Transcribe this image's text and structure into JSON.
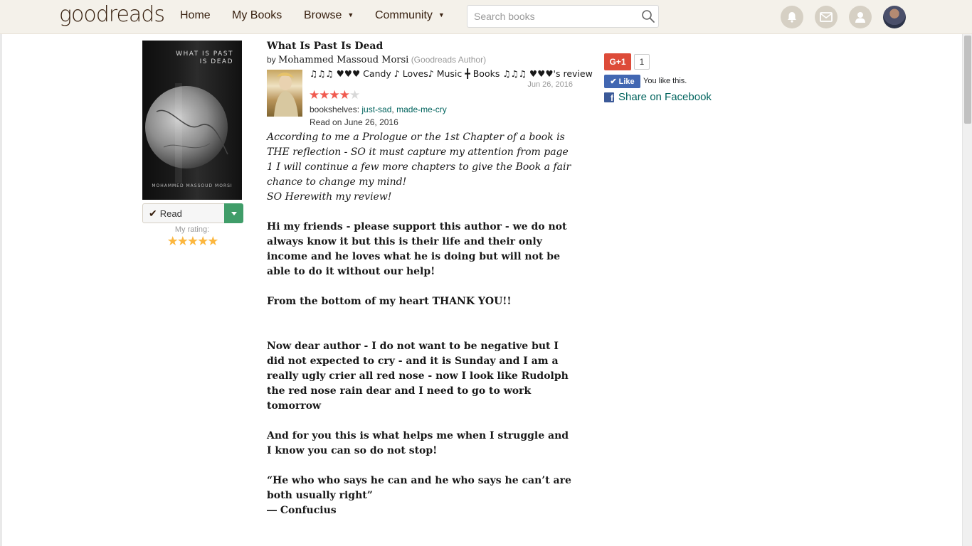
{
  "nav": {
    "logo_good": "good",
    "logo_reads": "reads",
    "home": "Home",
    "my_books": "My Books",
    "browse": "Browse",
    "community": "Community",
    "search_placeholder": "Search books"
  },
  "book": {
    "cover_title_line1": "WHAT IS PAST",
    "cover_title_line2": "IS DEAD",
    "cover_author": "MOHAMMED MASSOUD MORSI",
    "title": "What Is Past Is Dead",
    "by": "by",
    "author": "Mohammed Massoud Morsi",
    "author_badge": "(Goodreads Author)"
  },
  "shelf": {
    "read_label": "Read",
    "my_rating_label": "My rating:",
    "my_rating": 5,
    "my_rating_stars": "★★★★★"
  },
  "review": {
    "reviewer": "♫♫♫ ♥♥♥ Candy ♪ Loves♪ Music ╋ Books ♫♫♫ ♥♥♥'s review",
    "date": "Jun 26, 2016",
    "rating": 4,
    "rating_max": 5,
    "stars_on": "★★★★",
    "stars_off": "★",
    "bookshelves_label": "bookshelves:",
    "shelf1": "just-sad",
    "shelf_sep": ",",
    "shelf2": "made-me-cry",
    "read_on": "Read on June 26, 2016",
    "p1": "According to me a Prologue or the 1st Chapter of a book is THE reflection - SO it must capture my attention from page 1 I will continue a few more chapters to give the Book a fair chance to change my mind!",
    "p2": "SO Herewith my review!",
    "p3": "Hi my friends - please support this author - we do not always know it but this is their life and their only income and he loves what he is doing but will not be able to do it without our help!",
    "p4": "From the bottom of my heart THANK YOU!!",
    "p5": "Now dear author - I do not want to be negative but I did not expected to cry - and it is Sunday and I am a really ugly crier all red nose - now I look like Rudolph the red nose rain dear and I need to go to work tomorrow",
    "p6": "And for you this is what helps me when I struggle and I know you can so do not stop!",
    "p7": "“He who who says he can and he who says he can’t are both usually right”",
    "p8": "― Confucius"
  },
  "social": {
    "gplus_label": "G+1",
    "gplus_count": "1",
    "fb_like_label": "Like",
    "fb_like_text": "You like this.",
    "fb_share_label": "Share on Facebook"
  },
  "icons": {
    "search": "search-icon",
    "notifications": "bell-icon",
    "messages": "mail-icon",
    "friends": "friends-icon",
    "profile": "avatar",
    "check": "check-icon",
    "dropdown": "caret-down-icon",
    "facebook": "facebook-icon"
  },
  "colors": {
    "topbar_bg": "#f4f1ea",
    "brand_brown": "#382110",
    "shelf_green": "#409d69",
    "rating_orange": "#fcb73f",
    "review_star_red": "#f05a4f",
    "link_teal": "#00635d",
    "gplus_red": "#dd4b39",
    "facebook_blue": "#4267b2"
  }
}
